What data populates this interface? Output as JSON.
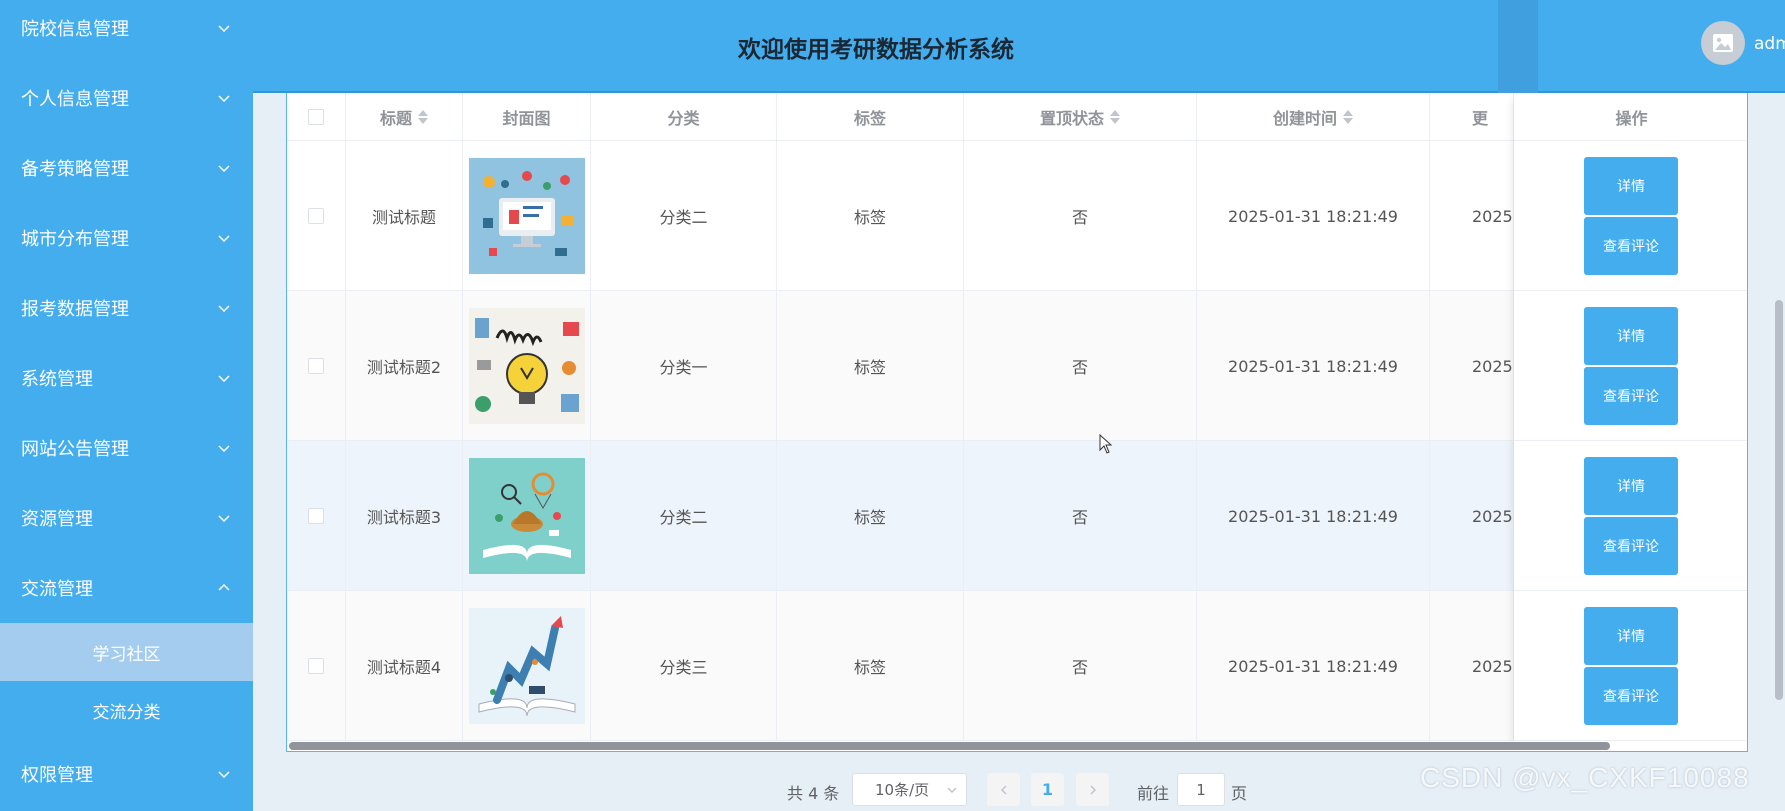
{
  "sidebar": {
    "menu": [
      {
        "label": "院校信息管理",
        "expanded": false
      },
      {
        "label": "个人信息管理",
        "expanded": false
      },
      {
        "label": "备考策略管理",
        "expanded": false
      },
      {
        "label": "城市分布管理",
        "expanded": false
      },
      {
        "label": "报考数据管理",
        "expanded": false
      },
      {
        "label": "系统管理",
        "expanded": false
      },
      {
        "label": "网站公告管理",
        "expanded": false
      },
      {
        "label": "资源管理",
        "expanded": false
      },
      {
        "label": "交流管理",
        "expanded": true
      },
      {
        "label": "权限管理",
        "expanded": false
      }
    ],
    "submenu": [
      {
        "label": "学习社区",
        "active": true
      },
      {
        "label": "交流分类",
        "active": false
      }
    ]
  },
  "header": {
    "title": "欢迎使用考研数据分析系统",
    "user": "adm",
    "avatar_icon": "image-icon"
  },
  "table": {
    "columns": {
      "title": "标题",
      "cover": "封面图",
      "category": "分类",
      "tag": "标签",
      "pinned": "置顶状态",
      "created": "创建时间",
      "updated": "更",
      "ops": "操作"
    },
    "rows": [
      {
        "title": "测试标题",
        "category": "分类二",
        "tag": "标签",
        "pinned": "否",
        "created": "2025-01-31 18:21:49",
        "updated": "2025-"
      },
      {
        "title": "测试标题2",
        "category": "分类一",
        "tag": "标签",
        "pinned": "否",
        "created": "2025-01-31 18:21:49",
        "updated": "2025-"
      },
      {
        "title": "测试标题3",
        "category": "分类二",
        "tag": "标签",
        "pinned": "否",
        "created": "2025-01-31 18:21:49",
        "updated": "2025-"
      },
      {
        "title": "测试标题4",
        "category": "分类三",
        "tag": "标签",
        "pinned": "否",
        "created": "2025-01-31 18:21:49",
        "updated": "2025-"
      }
    ],
    "buttons": {
      "detail": "详情",
      "comments": "查看评论"
    }
  },
  "pagination": {
    "total": "共 4 条",
    "page_size": "10条/页",
    "current": "1",
    "goto_label": "前往",
    "goto_value": "1",
    "page_label": "页"
  },
  "watermark": "CSDN @vx_CXKF10088",
  "colors": {
    "primary": "#44adee",
    "sidebar": "#44adee",
    "active_sub": "#a4ccee"
  }
}
